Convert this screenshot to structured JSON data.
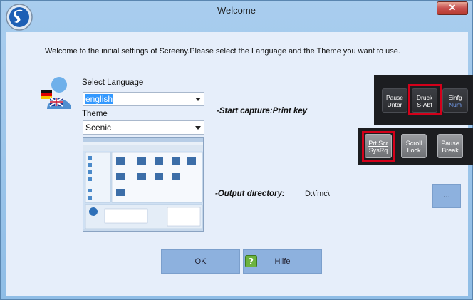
{
  "window": {
    "title": "Welcome",
    "close_label": "✕"
  },
  "intro_text": "Welcome to the initial settings of Screeny.Please select the Language and the Theme you want to use.",
  "language": {
    "label": "Select Language",
    "value": "english"
  },
  "theme": {
    "label": "Theme",
    "value": "Scenic"
  },
  "capture": {
    "label": "-Start capture:Print key"
  },
  "output": {
    "label": "-Output directory:",
    "path": "D:\\fmc\\",
    "browse_label": "..."
  },
  "keys": {
    "pause": [
      "Pause",
      "Untbr"
    ],
    "druck": [
      "Druck",
      "S-Abf"
    ],
    "einfg": [
      "Einfg",
      "Num"
    ],
    "prtscr": [
      "Prt Scr",
      "SysRq"
    ],
    "scroll": [
      "Scroll",
      "Lock"
    ],
    "pausebreak": [
      "Pause",
      "Break"
    ]
  },
  "buttons": {
    "ok": "OK",
    "help": "Hilfe"
  },
  "colors": {
    "accent": "#8db1de",
    "highlight": "#d4001a",
    "selection": "#3399ff"
  }
}
